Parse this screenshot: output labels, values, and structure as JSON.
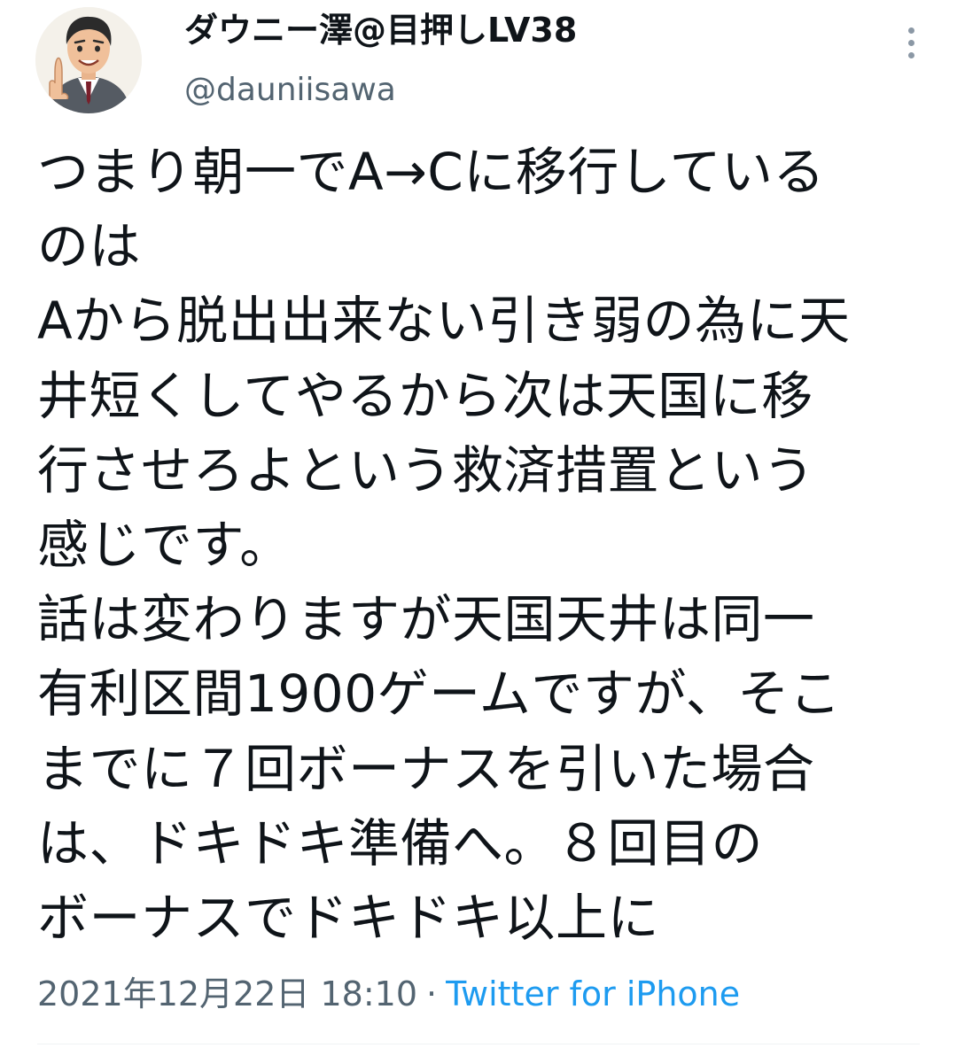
{
  "tweet": {
    "author": {
      "display_name": "ダウニー澤@目押しLV38",
      "handle": "@dauniisawa",
      "avatar_icon": "cartoon-man-avatar"
    },
    "more_icon": "vertical-dots-icon",
    "text": "つまり朝一でA→Cに移行している\nのは\nAから脱出出来ない引き弱の為に天\n井短くしてやるから次は天国に移\n行させろよという救済措置という\n感じです。\n話は変わりますが天国天井は同一\n有利区間1900ゲームですが、そこ\nまでに７回ボーナスを引いた場合\nは、ドキドキ準備へ。８回目の\nボーナスでドキドキ以上に",
    "timestamp": "2021年12月22日 18:10",
    "separator": "·",
    "source": "Twitter for iPhone"
  },
  "colors": {
    "text": "#0f1419",
    "secondary": "#536471",
    "link": "#1d9bf0",
    "divider": "#eff3f4"
  }
}
